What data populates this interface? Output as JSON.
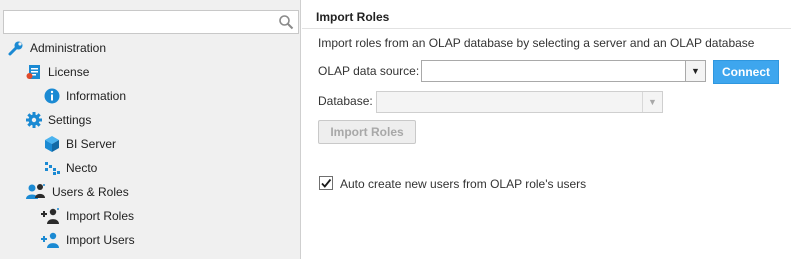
{
  "search": {
    "value": "",
    "placeholder": ""
  },
  "nav": {
    "items": [
      {
        "label": "Administration",
        "icon": "wrench-icon"
      },
      {
        "label": "License",
        "icon": "license-icon"
      },
      {
        "label": "Information",
        "icon": "info-icon"
      },
      {
        "label": "Settings",
        "icon": "gear-icon"
      },
      {
        "label": "BI Server",
        "icon": "cube-icon"
      },
      {
        "label": "Necto",
        "icon": "necto-icon"
      },
      {
        "label": "Users & Roles",
        "icon": "users-icon"
      },
      {
        "label": "Import Roles",
        "icon": "import-roles-icon"
      },
      {
        "label": "Import Users",
        "icon": "import-users-icon"
      }
    ]
  },
  "main": {
    "title": "Import Roles",
    "description": "Import roles from an OLAP database by selecting a server and an OLAP database",
    "olap_source": {
      "label": "OLAP data source:",
      "value": ""
    },
    "connect_label": "Connect",
    "database": {
      "label": "Database:",
      "value": ""
    },
    "import_button_label": "Import Roles",
    "auto_create": {
      "label": "Auto create new users from OLAP role's users",
      "checked": true
    }
  },
  "colors": {
    "accent": "#3ea6ee",
    "panel_bg": "#f0f0f0",
    "icon_blue": "#1b8ad3"
  }
}
